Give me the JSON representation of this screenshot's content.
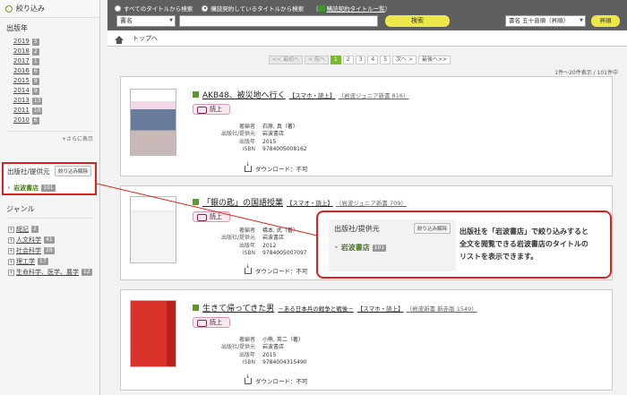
{
  "sidebar": {
    "refine_label": "絞り込み",
    "year_title": "出版年",
    "years": [
      {
        "year": "2019",
        "count": "5"
      },
      {
        "year": "2018",
        "count": "2"
      },
      {
        "year": "2017",
        "count": "1"
      },
      {
        "year": "2016",
        "count": "6"
      },
      {
        "year": "2015",
        "count": "9"
      },
      {
        "year": "2014",
        "count": "9"
      },
      {
        "year": "2013",
        "count": "13"
      },
      {
        "year": "2011",
        "count": "10"
      },
      {
        "year": "2010",
        "count": "6"
      }
    ],
    "more_label": "+さらに表示",
    "publisher_title": "出版社/提供元",
    "publisher_clear": "絞り込み解除",
    "publisher_item": "岩波書店",
    "publisher_count": "101",
    "genre_title": "ジャンル",
    "genres": [
      {
        "label": "総記",
        "count": "2"
      },
      {
        "label": "人文科学",
        "count": "41"
      },
      {
        "label": "社会科学",
        "count": "28"
      },
      {
        "label": "理工学",
        "count": "17"
      },
      {
        "label": "生命科学、医学、農学",
        "count": "12"
      }
    ]
  },
  "topbar": {
    "radio_all": "すべてのタイトルから検索",
    "radio_subscribed": "購読契約しているタイトルから検索",
    "subscribed_list": "購読契約タイトル一覧",
    "category_value": "書名",
    "search_value": "",
    "search_button": "検索",
    "sort_value": "書名 五十音順（昇順）",
    "asc_button": "昇順"
  },
  "breadcrumb": {
    "home": "トップへ"
  },
  "pager": {
    "first": "<< 最初へ",
    "prev": "< 前へ",
    "pages": [
      "1",
      "2",
      "3",
      "4",
      "5"
    ],
    "next": "次へ >",
    "last": "最後へ>>",
    "count_text": "1件〜20件表示 / 101件中"
  },
  "books": [
    {
      "title": "AKB48、被災地へ行く",
      "subtitle": "",
      "tag": "【スマホ・読上】",
      "series": "（岩波ジュニア新書 816）",
      "read": "読上",
      "author": "石原, 真（著）",
      "publisher": "岩波書店",
      "year": "2015",
      "isbn": "9784005008162",
      "download": "ダウンロード：不可"
    },
    {
      "title": "「銀の匙」の国語授業",
      "subtitle": "",
      "tag": "【スマオ・読上】",
      "series": "（岩波ジュニア新書 709）",
      "read": "読上",
      "author": "橋本, 武（著）",
      "publisher": "岩波書店",
      "year": "2012",
      "isbn": "9784005007097",
      "download": "ダウンロード：不可"
    },
    {
      "title": "生きて帰ってきた男",
      "subtitle": "－ある日本兵の戦争と戦後－",
      "tag": "【スマホ・読上】",
      "series": "（岩波新書 新赤版 1549）",
      "read": "読上",
      "author": "小熊, 英二（著）",
      "publisher": "岩波書店",
      "year": "2015",
      "isbn": "9784004315490",
      "download": "ダウンロード：不可"
    }
  ],
  "meta_labels": {
    "author": "著編者",
    "publisher": "出版社/提供元",
    "year": "出版年",
    "isbn": "ISBN"
  },
  "callout": {
    "title": "出版社/提供元",
    "clear": "絞り込み解除",
    "item": "岩波書店",
    "count": "101",
    "text_1": "出版社を「岩波書店」で絞り込みすると",
    "text_2": "全文を閲覧できる岩波書店のタイトルの",
    "text_3": "リストを表示できます。"
  },
  "colors": {
    "accent": "#7ab82e",
    "highlight": "#e0201a",
    "button": "#ece84a"
  }
}
